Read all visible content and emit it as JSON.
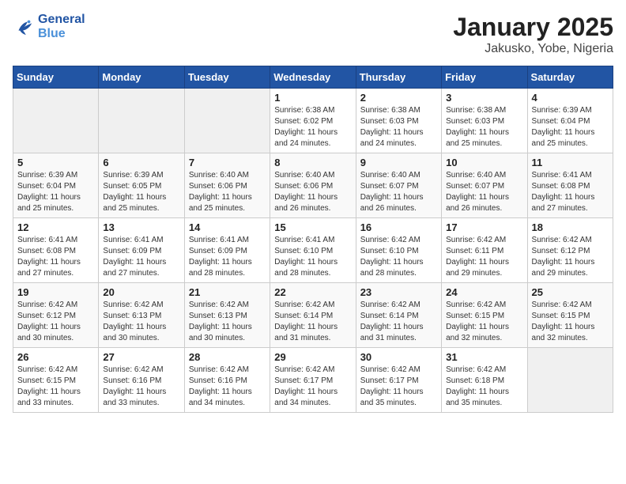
{
  "logo": {
    "line1": "General",
    "line2": "Blue"
  },
  "title": "January 2025",
  "subtitle": "Jakusko, Yobe, Nigeria",
  "weekdays": [
    "Sunday",
    "Monday",
    "Tuesday",
    "Wednesday",
    "Thursday",
    "Friday",
    "Saturday"
  ],
  "weeks": [
    [
      {
        "num": "",
        "info": ""
      },
      {
        "num": "",
        "info": ""
      },
      {
        "num": "",
        "info": ""
      },
      {
        "num": "1",
        "info": "Sunrise: 6:38 AM\nSunset: 6:02 PM\nDaylight: 11 hours\nand 24 minutes."
      },
      {
        "num": "2",
        "info": "Sunrise: 6:38 AM\nSunset: 6:03 PM\nDaylight: 11 hours\nand 24 minutes."
      },
      {
        "num": "3",
        "info": "Sunrise: 6:38 AM\nSunset: 6:03 PM\nDaylight: 11 hours\nand 25 minutes."
      },
      {
        "num": "4",
        "info": "Sunrise: 6:39 AM\nSunset: 6:04 PM\nDaylight: 11 hours\nand 25 minutes."
      }
    ],
    [
      {
        "num": "5",
        "info": "Sunrise: 6:39 AM\nSunset: 6:04 PM\nDaylight: 11 hours\nand 25 minutes."
      },
      {
        "num": "6",
        "info": "Sunrise: 6:39 AM\nSunset: 6:05 PM\nDaylight: 11 hours\nand 25 minutes."
      },
      {
        "num": "7",
        "info": "Sunrise: 6:40 AM\nSunset: 6:06 PM\nDaylight: 11 hours\nand 25 minutes."
      },
      {
        "num": "8",
        "info": "Sunrise: 6:40 AM\nSunset: 6:06 PM\nDaylight: 11 hours\nand 26 minutes."
      },
      {
        "num": "9",
        "info": "Sunrise: 6:40 AM\nSunset: 6:07 PM\nDaylight: 11 hours\nand 26 minutes."
      },
      {
        "num": "10",
        "info": "Sunrise: 6:40 AM\nSunset: 6:07 PM\nDaylight: 11 hours\nand 26 minutes."
      },
      {
        "num": "11",
        "info": "Sunrise: 6:41 AM\nSunset: 6:08 PM\nDaylight: 11 hours\nand 27 minutes."
      }
    ],
    [
      {
        "num": "12",
        "info": "Sunrise: 6:41 AM\nSunset: 6:08 PM\nDaylight: 11 hours\nand 27 minutes."
      },
      {
        "num": "13",
        "info": "Sunrise: 6:41 AM\nSunset: 6:09 PM\nDaylight: 11 hours\nand 27 minutes."
      },
      {
        "num": "14",
        "info": "Sunrise: 6:41 AM\nSunset: 6:09 PM\nDaylight: 11 hours\nand 28 minutes."
      },
      {
        "num": "15",
        "info": "Sunrise: 6:41 AM\nSunset: 6:10 PM\nDaylight: 11 hours\nand 28 minutes."
      },
      {
        "num": "16",
        "info": "Sunrise: 6:42 AM\nSunset: 6:10 PM\nDaylight: 11 hours\nand 28 minutes."
      },
      {
        "num": "17",
        "info": "Sunrise: 6:42 AM\nSunset: 6:11 PM\nDaylight: 11 hours\nand 29 minutes."
      },
      {
        "num": "18",
        "info": "Sunrise: 6:42 AM\nSunset: 6:12 PM\nDaylight: 11 hours\nand 29 minutes."
      }
    ],
    [
      {
        "num": "19",
        "info": "Sunrise: 6:42 AM\nSunset: 6:12 PM\nDaylight: 11 hours\nand 30 minutes."
      },
      {
        "num": "20",
        "info": "Sunrise: 6:42 AM\nSunset: 6:13 PM\nDaylight: 11 hours\nand 30 minutes."
      },
      {
        "num": "21",
        "info": "Sunrise: 6:42 AM\nSunset: 6:13 PM\nDaylight: 11 hours\nand 30 minutes."
      },
      {
        "num": "22",
        "info": "Sunrise: 6:42 AM\nSunset: 6:14 PM\nDaylight: 11 hours\nand 31 minutes."
      },
      {
        "num": "23",
        "info": "Sunrise: 6:42 AM\nSunset: 6:14 PM\nDaylight: 11 hours\nand 31 minutes."
      },
      {
        "num": "24",
        "info": "Sunrise: 6:42 AM\nSunset: 6:15 PM\nDaylight: 11 hours\nand 32 minutes."
      },
      {
        "num": "25",
        "info": "Sunrise: 6:42 AM\nSunset: 6:15 PM\nDaylight: 11 hours\nand 32 minutes."
      }
    ],
    [
      {
        "num": "26",
        "info": "Sunrise: 6:42 AM\nSunset: 6:15 PM\nDaylight: 11 hours\nand 33 minutes."
      },
      {
        "num": "27",
        "info": "Sunrise: 6:42 AM\nSunset: 6:16 PM\nDaylight: 11 hours\nand 33 minutes."
      },
      {
        "num": "28",
        "info": "Sunrise: 6:42 AM\nSunset: 6:16 PM\nDaylight: 11 hours\nand 34 minutes."
      },
      {
        "num": "29",
        "info": "Sunrise: 6:42 AM\nSunset: 6:17 PM\nDaylight: 11 hours\nand 34 minutes."
      },
      {
        "num": "30",
        "info": "Sunrise: 6:42 AM\nSunset: 6:17 PM\nDaylight: 11 hours\nand 35 minutes."
      },
      {
        "num": "31",
        "info": "Sunrise: 6:42 AM\nSunset: 6:18 PM\nDaylight: 11 hours\nand 35 minutes."
      },
      {
        "num": "",
        "info": ""
      }
    ]
  ]
}
